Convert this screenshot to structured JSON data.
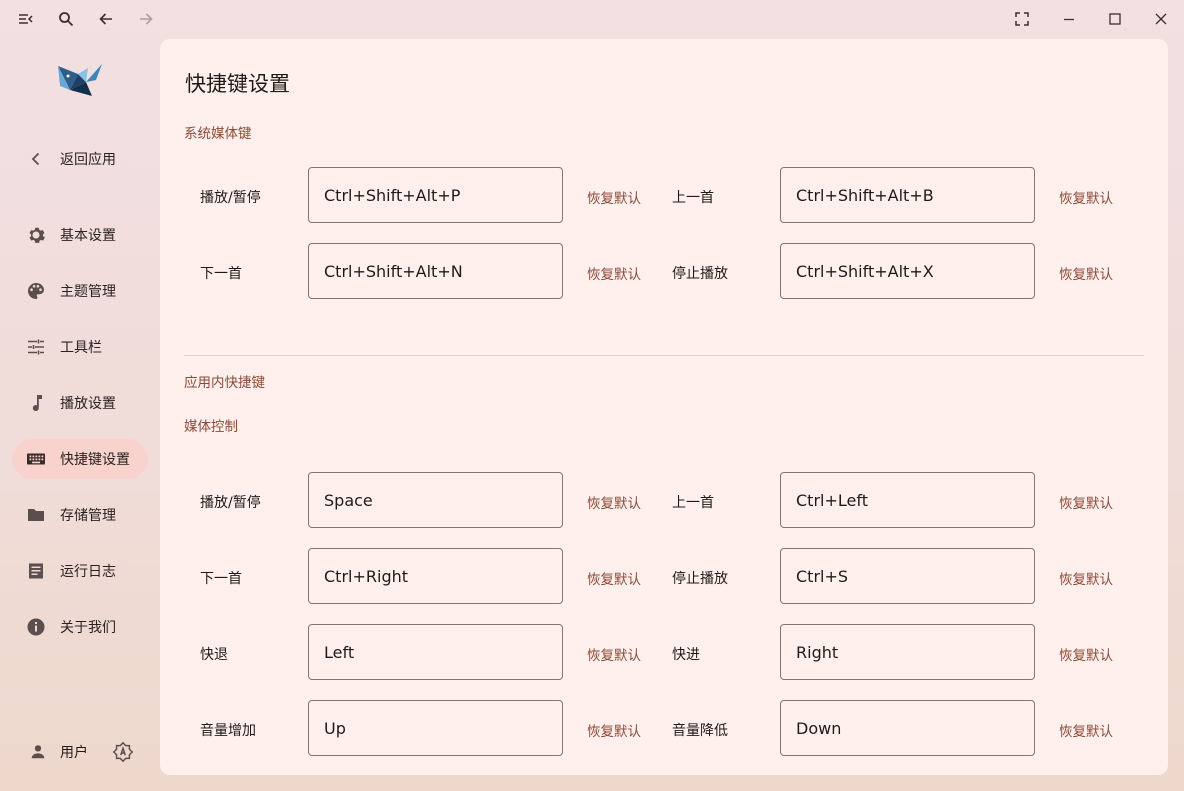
{
  "titlebar": {
    "menu_icon": "menu-collapse-icon",
    "search_icon": "search-icon",
    "back_icon": "arrow-left-icon",
    "forward_icon": "arrow-right-icon",
    "fullscreen_icon": "fullscreen-icon",
    "minimize_icon": "minimize-icon",
    "maximize_icon": "maximize-icon",
    "close_icon": "close-icon"
  },
  "sidebar": {
    "back_label": "返回应用",
    "items": [
      {
        "label": "基本设置",
        "icon": "gear-icon"
      },
      {
        "label": "主题管理",
        "icon": "palette-icon"
      },
      {
        "label": "工具栏",
        "icon": "tune-icon"
      },
      {
        "label": "播放设置",
        "icon": "music-note-icon"
      },
      {
        "label": "快捷键设置",
        "icon": "keyboard-icon",
        "active": true
      },
      {
        "label": "存储管理",
        "icon": "folder-icon"
      },
      {
        "label": "运行日志",
        "icon": "document-icon"
      },
      {
        "label": "关于我们",
        "icon": "info-icon"
      }
    ],
    "user_label": "用户"
  },
  "main": {
    "title": "快捷键设置",
    "system_section": "系统媒体键",
    "app_section": "应用内快捷键",
    "media_control": "媒体控制",
    "reset_label": "恢复默认",
    "system_rows": [
      {
        "left_label": "播放/暂停",
        "left_value": "Ctrl+Shift+Alt+P",
        "right_label": "上一首",
        "right_value": "Ctrl+Shift+Alt+B"
      },
      {
        "left_label": "下一首",
        "left_value": "Ctrl+Shift+Alt+N",
        "right_label": "停止播放",
        "right_value": "Ctrl+Shift+Alt+X"
      }
    ],
    "app_rows": [
      {
        "left_label": "播放/暂停",
        "left_value": "Space",
        "right_label": "上一首",
        "right_value": "Ctrl+Left"
      },
      {
        "left_label": "下一首",
        "left_value": "Ctrl+Right",
        "right_label": "停止播放",
        "right_value": "Ctrl+S"
      },
      {
        "left_label": "快退",
        "left_value": "Left",
        "right_label": "快进",
        "right_value": "Right"
      },
      {
        "left_label": "音量增加",
        "left_value": "Up",
        "right_label": "音量降低",
        "right_value": "Down"
      }
    ]
  },
  "colors": {
    "accent": "#8c4a38",
    "active_nav_bg": "#f8d3cd",
    "panel_bg": "#fff0ed"
  }
}
